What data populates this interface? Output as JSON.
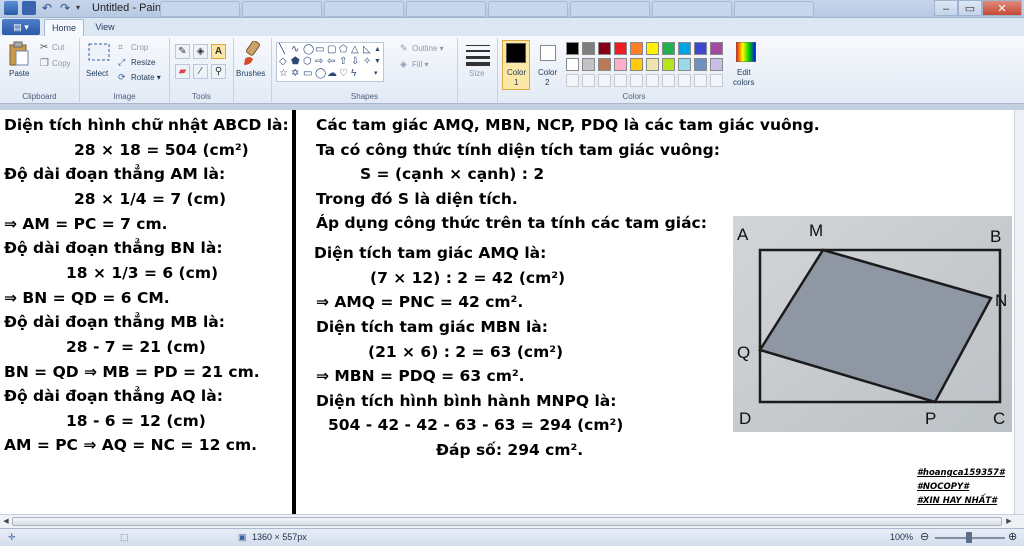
{
  "window": {
    "title": "Untitled - Paint"
  },
  "tabs": {
    "file": "▤ ▾",
    "home": "Home",
    "view": "View"
  },
  "ribbon": {
    "clipboard": {
      "group_label": "Clipboard",
      "paste": "Paste",
      "cut": "Cut",
      "copy": "Copy"
    },
    "image": {
      "group_label": "Image",
      "select": "Select",
      "crop": "Crop",
      "resize": "Resize",
      "rotate": "Rotate ▾"
    },
    "tools": {
      "group_label": "Tools"
    },
    "brushes": {
      "label": "Brushes"
    },
    "shapes": {
      "group_label": "Shapes",
      "outline": "Outline ▾",
      "fill": "Fill ▾"
    },
    "size": {
      "label": "Size"
    },
    "color1": {
      "label": "Color",
      "sub": "1",
      "value": "#000000"
    },
    "color2": {
      "label": "Color",
      "sub": "2",
      "value": "#ffffff"
    },
    "colors": {
      "group_label": "Colors",
      "palette_row1": [
        "#000000",
        "#7f7f7f",
        "#880015",
        "#ed1c24",
        "#ff7f27",
        "#fff200",
        "#22b14c",
        "#00a2e8",
        "#3f48cc",
        "#a349a4"
      ],
      "palette_row2": [
        "#ffffff",
        "#c3c3c3",
        "#b97a57",
        "#ffaec9",
        "#ffc90e",
        "#efe4b0",
        "#b5e61d",
        "#99d9ea",
        "#7092be",
        "#c8bfe7"
      ]
    },
    "edit_colors": {
      "line1": "Edit",
      "line2": "colors"
    }
  },
  "left_column": [
    "Diện tích hình chữ nhật ABCD là:",
    "28 × 18 = 504 (cm²)",
    "Độ dài đoạn thẳng AM là:",
    "28 × 1/4 = 7 (cm)",
    "⇒ AM = PC = 7 cm.",
    "Độ dài đoạn thẳng BN là:",
    "18 × 1/3 = 6 (cm)",
    "⇒ BN = QD = 6 CM.",
    "Độ dài đoạn thẳng MB là:",
    "28 - 7 = 21 (cm)",
    "BN = QD ⇒ MB = PD = 21 cm.",
    "Độ dài đoạn thẳng AQ là:",
    "18 - 6 = 12 (cm)",
    "AM = PC ⇒ AQ = NC = 12 cm."
  ],
  "right_column": [
    "Các tam giác AMQ, MBN, NCP, PDQ là các tam giác vuông.",
    "Ta có công thức tính diện tích tam giác vuông:",
    "S = (cạnh × cạnh) : 2",
    "Trong đó S là diện tích.",
    "Áp dụng công thức trên ta tính các tam giác:",
    "Diện tích tam giác AMQ là:",
    "(7 × 12) : 2 = 42 (cm²)",
    "⇒ AMQ = PNC = 42 cm².",
    "Diện tích tam giác MBN là:",
    "(21 × 6) : 2 = 63 (cm²)",
    "⇒ MBN = PDQ = 63 cm².",
    "Diện tích hình bình hành MNPQ là:",
    "504 - 42 - 42 - 63 - 63 = 294 (cm²)",
    "Đáp số: 294 cm²."
  ],
  "figure": {
    "labels": {
      "A": "A",
      "M": "M",
      "B": "B",
      "N": "N",
      "Q": "Q",
      "D": "D",
      "P": "P",
      "C": "C"
    }
  },
  "tags": [
    "#hoangca159357#",
    "#NOCOPY#",
    "#XIN HAY NHẤT#"
  ],
  "statusbar": {
    "dimensions": "1360 × 557px",
    "zoom": "100%"
  }
}
